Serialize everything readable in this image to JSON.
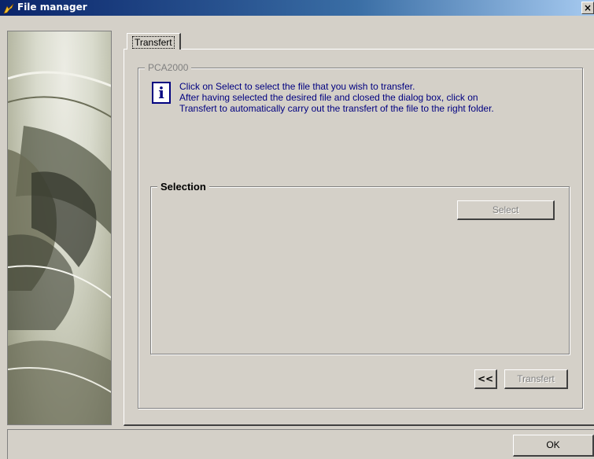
{
  "window": {
    "title": "File manager",
    "close_glyph": "×"
  },
  "tabs": [
    {
      "label": "Transfert",
      "active": true
    }
  ],
  "group": {
    "legend": "PCA2000",
    "info_icon_glyph": "i",
    "info_lines": [
      "Click on Select to select the file that you wish to transfer.",
      "After having selected the desired file and closed the dialog box, click on",
      "Transfert to automatically carry out the transfert of the file to the right folder."
    ]
  },
  "selection": {
    "legend": "Selection",
    "select_label": "Select"
  },
  "actions": {
    "back_label": "<<",
    "transfer_label": "Transfert",
    "ok_label": "OK"
  },
  "colors": {
    "titlebar_start": "#0a246a",
    "info_text": "#000080",
    "face": "#d4d0c8"
  }
}
